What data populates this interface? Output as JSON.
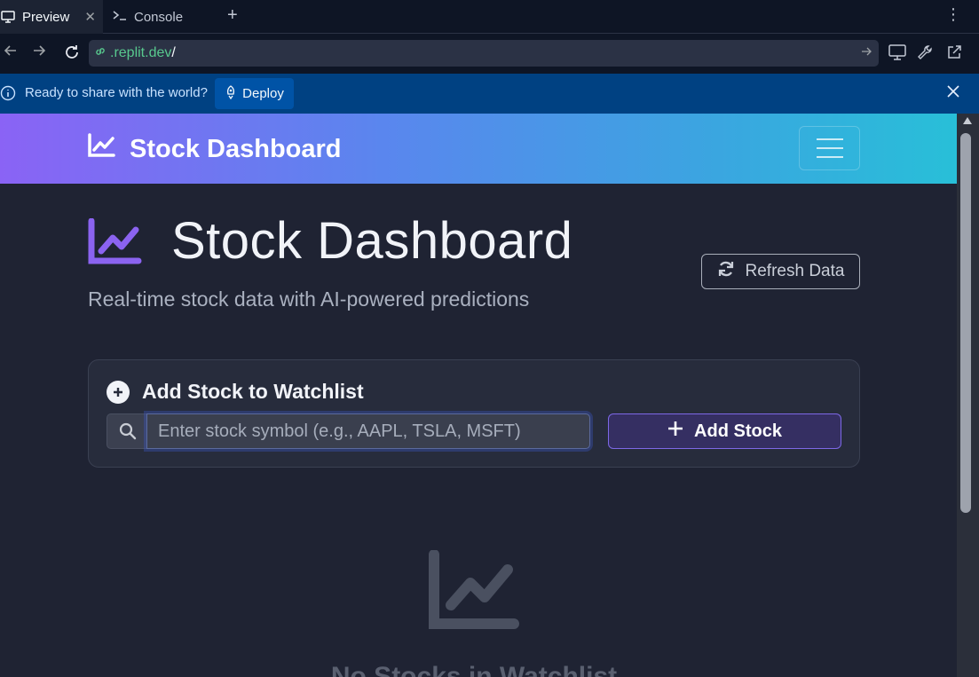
{
  "tabs": [
    {
      "label": "Preview",
      "icon": "monitor-icon",
      "active": true
    },
    {
      "label": "Console",
      "icon": "terminal-icon",
      "active": false
    }
  ],
  "browser": {
    "url_host": ".replit.dev",
    "url_path": "/"
  },
  "deploy_banner": {
    "message": "Ready to share with the world?",
    "button_label": "Deploy"
  },
  "navbar": {
    "brand": "Stock Dashboard"
  },
  "hero": {
    "title": "Stock Dashboard",
    "subtitle": "Real-time stock data with AI-powered predictions",
    "refresh_label": "Refresh Data"
  },
  "watchlist_card": {
    "title": "Add Stock to Watchlist",
    "input_placeholder": "Enter stock symbol (e.g., AAPL, TSLA, MSFT)",
    "input_value": "",
    "add_label": "Add Stock"
  },
  "empty_state": {
    "title": "No Stocks in Watchlist"
  },
  "colors": {
    "accent": "#7d68e6",
    "deploy_bar": "#004182",
    "url_host": "#58c98e"
  }
}
